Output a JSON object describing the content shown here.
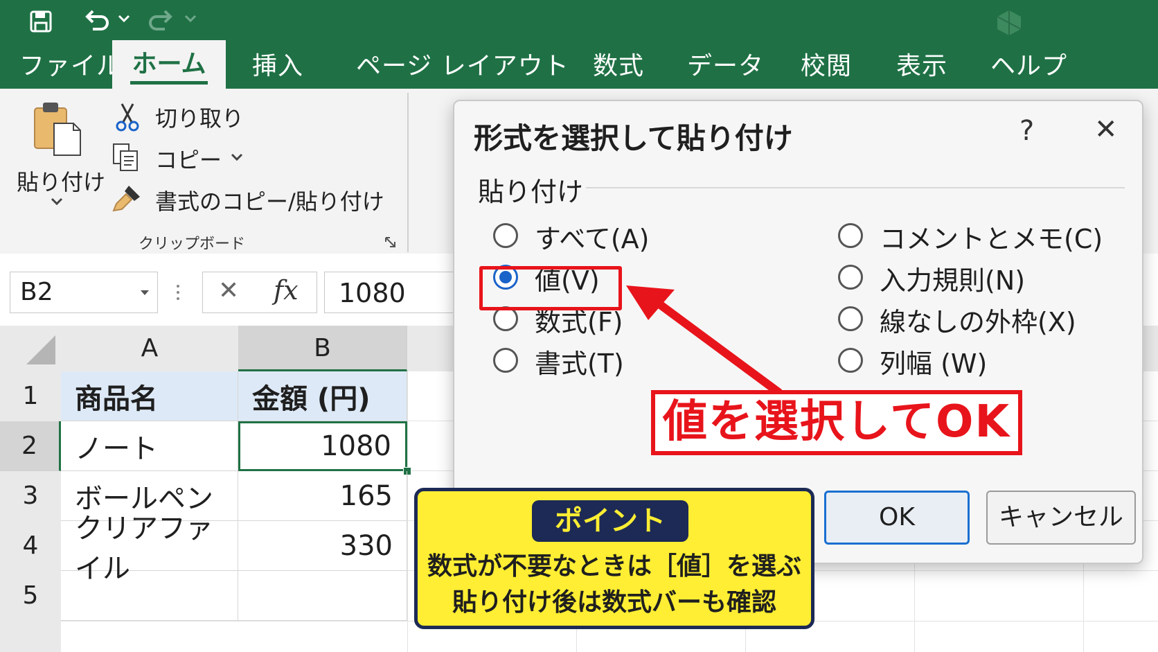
{
  "qat": {
    "save_icon": "save-icon",
    "undo_icon": "undo-icon",
    "redo_icon": "redo-icon",
    "chevron": "⌄"
  },
  "tabs": [
    "ファイル",
    "ホーム",
    "挿入",
    "ページ レイアウト",
    "数式",
    "データ",
    "校閲",
    "表示",
    "ヘルプ"
  ],
  "ribbon": {
    "paste_label": "貼り付け",
    "cut_label": "切り取り",
    "copy_label": "コピー",
    "format_painter_label": "書式のコピー/貼り付け",
    "group_label": "クリップボード"
  },
  "formula_bar": {
    "name_box": "B2",
    "cancel_symbol": "✕",
    "fx_symbol": "fx",
    "value": "1080"
  },
  "sheet": {
    "columns": [
      "A",
      "B"
    ],
    "rows": [
      "1",
      "2",
      "3",
      "4",
      "5"
    ],
    "header": [
      "商品名",
      "金額 (円)"
    ],
    "data": [
      [
        "ノート",
        "1080"
      ],
      [
        "ボールペン",
        "165"
      ],
      [
        "クリアファイル",
        "330"
      ]
    ]
  },
  "dialog": {
    "title": "形式を選択して貼り付け",
    "help": "?",
    "close": "✕",
    "section": "貼り付け",
    "options_left": [
      "すべて(A)",
      "値(V)",
      "数式(F)",
      "書式(T)"
    ],
    "options_right": [
      "コメントとメモ(C)",
      "入力規則(N)",
      "線なしの外枠(X)",
      "列幅 (W)"
    ],
    "selected": "値(V)",
    "ok_label": "OK",
    "cancel_label": "キャンセル"
  },
  "annotation": {
    "callout": "値を選択してOK",
    "point_badge": "ポイント",
    "point_line1": "数式が不要なときは［値］を選ぶ",
    "point_line2": "貼り付け後は数式バーも確認"
  },
  "colors": {
    "excel_green": "#1f7145",
    "accent_red": "#e8141b",
    "radio_blue": "#1a63c9",
    "note_yellow": "#ffee33",
    "note_navy": "#1c2a55"
  }
}
